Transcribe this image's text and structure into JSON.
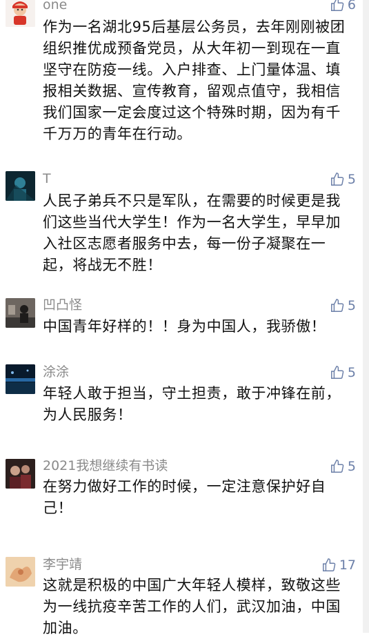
{
  "comments": [
    {
      "name": "one",
      "likes": "6",
      "text": "作为一名湖北95后基层公务员，去年刚刚被团组织推优成预备党员，从大年初一到现在一直坚守在防疫一线。入户排查、上门量体温、填报相关数据、宣传教育，留观点值守，我相信我们国家一定会度过这个特殊时期，因为有千千万万的青年在行动。"
    },
    {
      "name": "T",
      "likes": "5",
      "text": "人民子弟兵不只是军队，在需要的时候更是我们这些当代大学生！作为一名大学生，早早加入社区志愿者服务中去，每一份子凝聚在一起，将战无不胜！"
    },
    {
      "name": "凹凸怪",
      "likes": "5",
      "text": "中国青年好样的！！身为中国人，我骄傲！"
    },
    {
      "name": "涂涂",
      "likes": "5",
      "text": "年轻人敢于担当，守土担责，敢于冲锋在前，为人民服务！"
    },
    {
      "name": "2021我想继续有书读",
      "likes": "5",
      "text": "在努力做好工作的时候，一定注意保护好自己！"
    },
    {
      "name": "李宇靖",
      "likes": "17",
      "text": "这就是积极的中国广大年轻人模样，致敬这些为一线抗疫辛苦工作的人们，武汉加油，中国加油。"
    }
  ]
}
